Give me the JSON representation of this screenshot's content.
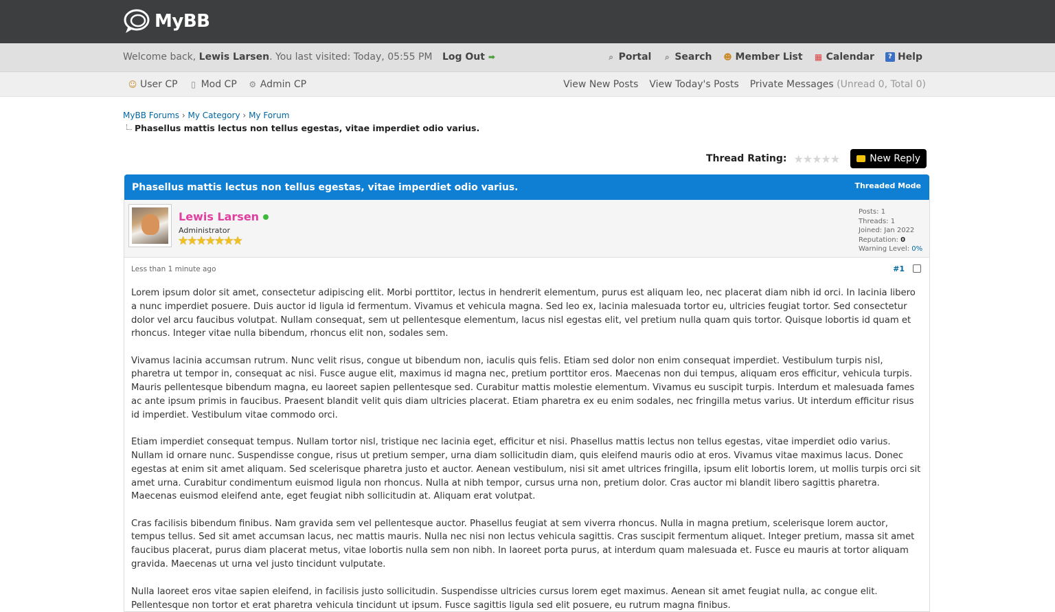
{
  "header": {
    "logo_text": "MyBB"
  },
  "welcome": {
    "prefix": "Welcome back, ",
    "user": "Lewis Larsen",
    "visited": ". You last visited: Today, 05:55 PM",
    "logout": "Log Out"
  },
  "topnav": [
    {
      "label": "Portal",
      "icon": "portal-icon"
    },
    {
      "label": "Search",
      "icon": "search-icon"
    },
    {
      "label": "Member List",
      "icon": "members-icon"
    },
    {
      "label": "Calendar",
      "icon": "calendar-icon"
    },
    {
      "label": "Help",
      "icon": "help-icon"
    }
  ],
  "subnav": {
    "user_cp": "User CP",
    "mod_cp": "Mod CP",
    "admin_cp": "Admin CP",
    "view_new": "View New Posts",
    "view_today": "View Today's Posts",
    "pm": "Private Messages",
    "pm_counts": "(Unread 0, Total 0)"
  },
  "breadcrumb": {
    "items": [
      "MyBB Forums",
      "My Category",
      "My Forum"
    ],
    "separator": "›",
    "current": "Phasellus mattis lectus non tellus egestas, vitae imperdiet odio varius."
  },
  "thread": {
    "rating_label": "Thread Rating:",
    "rating_stars": "★★★★★",
    "new_reply": "New Reply",
    "title": "Phasellus mattis lectus non tellus egestas, vitae imperdiet odio varius.",
    "mode": "Threaded Mode",
    "header_color": "#0f7fd3"
  },
  "post": {
    "author": "Lewis Larsen",
    "role": "Administrator",
    "author_stars": "★★★★★★★",
    "stats": {
      "posts_label": "Posts:",
      "posts": "1",
      "threads_label": "Threads:",
      "threads": "1",
      "joined_label": "Joined:",
      "joined": "Jan 2022",
      "rep_label": "Reputation:",
      "rep": "0",
      "warn_label": "Warning Level:",
      "warn": "0%"
    },
    "date": "Less than 1 minute ago",
    "number": "#1",
    "paragraphs": [
      "Lorem ipsum dolor sit amet, consectetur adipiscing elit. Morbi porttitor, lectus in hendrerit elementum, purus est aliquam leo, nec placerat diam nibh id orci. In lacinia libero a nunc imperdiet posuere. Duis auctor id ligula id fermentum. Vivamus et vehicula magna. Sed leo ex, lacinia malesuada tortor eu, ultricies feugiat tortor. Sed consectetur dolor vel arcu faucibus volutpat. Nullam consequat, sem ut pellentesque elementum, lacus nisl egestas elit, vel pretium nulla quam quis tortor. Quisque lobortis id quam et rhoncus. Integer vitae nulla bibendum, rhoncus elit non, sodales sem.",
      "Vivamus lacinia accumsan rutrum. Nunc velit risus, congue ut bibendum non, iaculis quis felis. Etiam sed dolor non enim consequat imperdiet. Vestibulum turpis nisl, pharetra ut tempor in, consequat ac nisi. Fusce augue elit, maximus id magna nec, pretium porttitor eros. Maecenas non dui tempus, aliquam eros efficitur, vehicula turpis. Mauris pellentesque bibendum magna, eu laoreet sapien pellentesque sed. Curabitur mattis molestie elementum. Vivamus eu suscipit turpis. Interdum et malesuada fames ac ante ipsum primis in faucibus. Praesent blandit velit quis diam ultricies placerat. Etiam pharetra ex eu enim sodales, nec fringilla metus varius. Ut interdum efficitur risus id imperdiet. Vestibulum vitae commodo orci.",
      "Etiam imperdiet consequat tempus. Nullam tortor nisl, tristique nec lacinia eget, efficitur et nisi. Phasellus mattis lectus non tellus egestas, vitae imperdiet odio varius. Nullam id ornare nunc. Suspendisse congue, risus ut pretium semper, urna diam sollicitudin diam, quis eleifend mauris odio at eros. Vivamus vitae maximus lacus. Donec egestas at enim sit amet aliquam. Sed scelerisque pharetra justo et auctor. Aenean vestibulum, nisi sit amet ultrices fringilla, ipsum elit lobortis lorem, ut mollis turpis orci sit amet urna. Curabitur condimentum euismod ligula non rhoncus. Nulla at nibh tempor, cursus urna non, pretium dolor. Cras auctor mi blandit libero sagittis pharetra. Maecenas euismod eleifend ante, eget feugiat nibh sollicitudin at. Aliquam erat volutpat.",
      "Cras facilisis bibendum finibus. Nam gravida sem vel pellentesque auctor. Phasellus feugiat at sem viverra rhoncus. Nulla in magna pretium, scelerisque lorem auctor, tempus tellus. Sed sit amet accumsan lacus, nec mattis mauris. Nulla nec nisi non lectus vehicula sagittis. Cras suscipit fermentum aliquet. Integer pretium, massa sit amet faucibus placerat, purus diam placerat metus, vitae lobortis nulla sem non nibh. In laoreet porta purus, at interdum quam malesuada et. Fusce eu mauris at tortor aliquam gravida. Maecenas ut urna vel justo tincidunt vulputate.",
      "Nulla laoreet eros vitae sapien eleifend, in facilisis justo sollicitudin. Suspendisse ultricies cursus lorem eget maximus. Aenean sit amet feugiat nulla, ac congue elit. Pellentesque non tortor et erat pharetra vehicula tincidunt ut ipsum. Fusce sagittis ligula sed elit posuere, eu rutrum magna finibus."
    ]
  }
}
